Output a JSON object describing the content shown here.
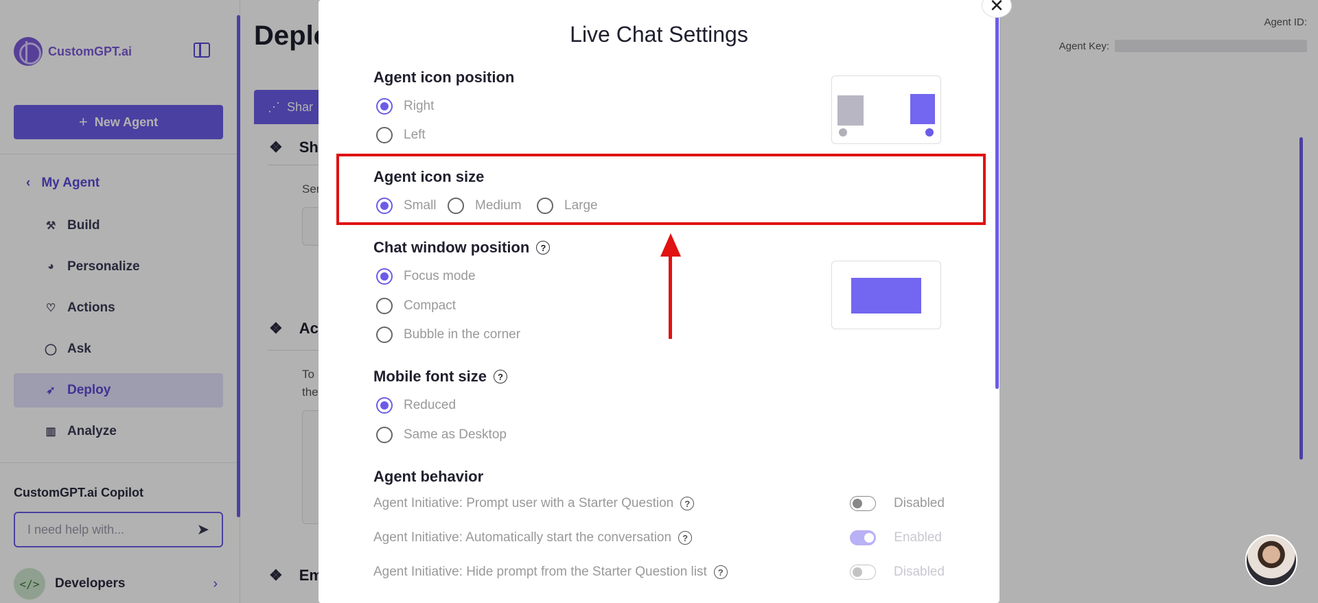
{
  "sidebar": {
    "brand": "CustomGPT.ai",
    "new_agent": "New Agent",
    "my_agent": "My Agent",
    "nav": [
      {
        "label": "Build",
        "icon": "build-icon"
      },
      {
        "label": "Personalize",
        "icon": "palette-icon"
      },
      {
        "label": "Actions",
        "icon": "actions-icon"
      },
      {
        "label": "Ask",
        "icon": "chat-icon"
      },
      {
        "label": "Deploy",
        "icon": "rocket-icon"
      },
      {
        "label": "Analyze",
        "icon": "chart-icon"
      }
    ],
    "copilot_title": "CustomGPT.ai Copilot",
    "copilot_placeholder": "I need help with...",
    "developers": "Developers"
  },
  "main": {
    "page_title": "Deplo",
    "agent_id_label": "Agent ID:",
    "agent_key_label": "Agent Key:",
    "share_tab": "Shar",
    "sections": [
      "Sh",
      "Ac",
      "Em"
    ],
    "snippets": [
      "Ser",
      "To",
      "the"
    ]
  },
  "modal": {
    "title": "Live Chat Settings",
    "icon_position": {
      "label": "Agent icon position",
      "options": [
        "Right",
        "Left"
      ],
      "selected": "Right"
    },
    "icon_size": {
      "label": "Agent icon size",
      "options": [
        "Small",
        "Medium",
        "Large"
      ],
      "selected": "Small"
    },
    "chat_window": {
      "label": "Chat window position",
      "options": [
        "Focus mode",
        "Compact",
        "Bubble in the corner"
      ],
      "selected": "Focus mode"
    },
    "mobile_font": {
      "label": "Mobile font size",
      "options": [
        "Reduced",
        "Same as Desktop"
      ],
      "selected": "Reduced"
    },
    "behavior": {
      "label": "Agent behavior",
      "rows": [
        {
          "label": "Agent Initiative: Prompt user with a Starter Question",
          "state": "Disabled"
        },
        {
          "label": "Agent Initiative: Automatically start the conversation",
          "state": "Enabled"
        },
        {
          "label": "Agent Initiative: Hide prompt from the Starter Question list",
          "state": "Disabled"
        }
      ]
    }
  },
  "colors": {
    "accent": "#6b5ce7",
    "highlight": "#e01212"
  }
}
